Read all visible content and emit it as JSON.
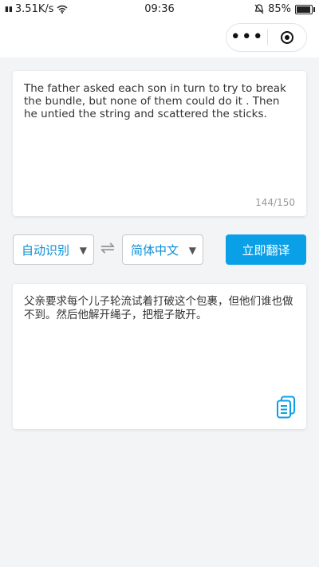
{
  "status_bar": {
    "signal_text": "4G",
    "speed": "3.51K/s",
    "time": "09:36",
    "battery_percent": "85%",
    "battery_level": 0.85
  },
  "nav": {
    "more_icon": "more-dots-icon",
    "close_icon": "target-icon"
  },
  "source": {
    "text": "The father asked each son in turn to try to break the bundle, but none of them could do it . Then he untied the string and scattered the sticks.",
    "counter": "144/150"
  },
  "languages": {
    "source_label": "自动识别",
    "target_label": "简体中文",
    "swap_symbol": "⇌",
    "translate_button": "立即翻译"
  },
  "result": {
    "text": "父亲要求每个儿子轮流试着打破这个包裹，但他们谁也做不到。然后他解开绳子，把棍子散开。"
  },
  "colors": {
    "accent": "#0aa0e8",
    "select_text": "#0a8fd6"
  }
}
